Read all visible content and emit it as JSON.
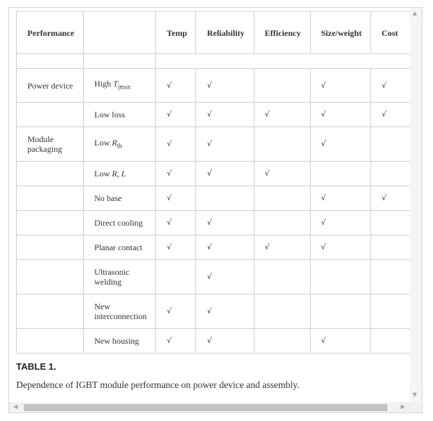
{
  "table": {
    "headers": [
      "Performance",
      "",
      "Temp",
      "Reliability",
      "Efficiency",
      "Size/weight",
      "Cost"
    ],
    "rows": [
      {
        "group": "Power device",
        "item": "High ",
        "item_var": "T",
        "item_sub": "jmax",
        "checks": [
          "√",
          "√",
          "",
          "√",
          "√"
        ]
      },
      {
        "group": "",
        "item": "Low loss",
        "checks": [
          "√",
          "√",
          "√",
          "√",
          "√"
        ]
      },
      {
        "group": "Module packaging",
        "item": "Low ",
        "item_var": "R",
        "item_sub": "th",
        "checks": [
          "√",
          "√",
          "",
          "√",
          ""
        ]
      },
      {
        "group": "",
        "item": "Low ",
        "item_var": "R, L",
        "checks": [
          "√",
          "√",
          "√",
          "",
          ""
        ]
      },
      {
        "group": "",
        "item": "No base",
        "checks": [
          "√",
          "",
          "",
          "√",
          "√"
        ]
      },
      {
        "group": "",
        "item": "Direct cooling",
        "checks": [
          "√",
          "√",
          "",
          "√",
          ""
        ]
      },
      {
        "group": "",
        "item": "Planar contact",
        "checks": [
          "√",
          "√",
          "√",
          "√",
          ""
        ]
      },
      {
        "group": "",
        "item": "Ultrasonic welding",
        "checks": [
          "",
          "√",
          "",
          "",
          ""
        ]
      },
      {
        "group": "",
        "item": "New interconnection",
        "checks": [
          "√",
          "√",
          "",
          "",
          ""
        ]
      },
      {
        "group": "",
        "item": "New housing",
        "checks": [
          "√",
          "√",
          "",
          "√",
          ""
        ]
      }
    ]
  },
  "caption": {
    "label": "TABLE 1.",
    "text": "Dependence of IGBT module performance on power device and assembly."
  },
  "scrollbar": {
    "up_arrow": "▲",
    "down_arrow": "▼",
    "left_arrow": "◀",
    "right_arrow": "▶"
  }
}
